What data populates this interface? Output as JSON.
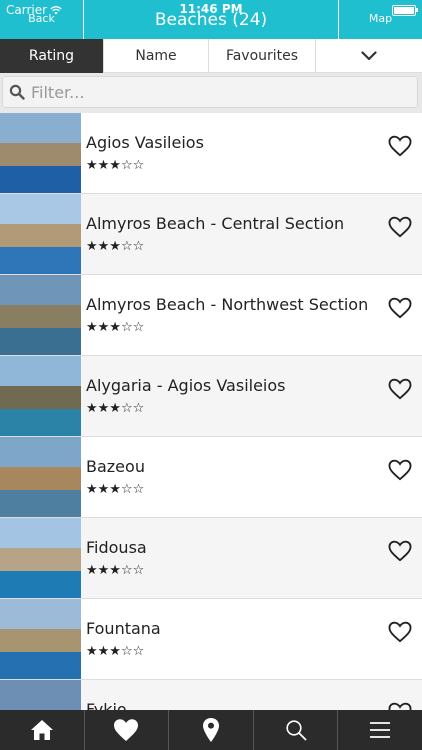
{
  "status": {
    "carrier": "Carrier",
    "time": "11:46 PM"
  },
  "header": {
    "back_label": "Back",
    "title": "Beaches (24)",
    "map_label": "Map"
  },
  "tabs": {
    "rating": "Rating",
    "name": "Name",
    "favourites": "Favourites"
  },
  "search": {
    "placeholder": "Filter..."
  },
  "beaches": [
    {
      "name": "Agios Vasileios",
      "stars": "★★★☆☆",
      "colors": {
        "sky": "#8aaed0",
        "land": "#9e8b6e",
        "sea": "#1f5fa5"
      }
    },
    {
      "name": "Almyros Beach - Central Section",
      "stars": "★★★☆☆",
      "colors": {
        "sky": "#a9c8e6",
        "land": "#b29a78",
        "sea": "#2f76b8"
      }
    },
    {
      "name": "Almyros Beach - Northwest Section",
      "stars": "★★★☆☆",
      "colors": {
        "sky": "#6f95b9",
        "land": "#8a7e62",
        "sea": "#3a6f92"
      }
    },
    {
      "name": "Alygaria - Agios Vasileios",
      "stars": "★★★☆☆",
      "colors": {
        "sky": "#90b7d8",
        "land": "#6f6a50",
        "sea": "#2b83a8"
      }
    },
    {
      "name": "Bazeou",
      "stars": "★★★☆☆",
      "colors": {
        "sky": "#7ea6c9",
        "land": "#a8865e",
        "sea": "#4e7fa0"
      }
    },
    {
      "name": "Fidousa",
      "stars": "★★★☆☆",
      "colors": {
        "sky": "#a3c5e3",
        "land": "#b7a488",
        "sea": "#1f7bb3"
      }
    },
    {
      "name": "Fountana",
      "stars": "★★★☆☆",
      "colors": {
        "sky": "#9bbbd9",
        "land": "#a79471",
        "sea": "#2470b0"
      }
    },
    {
      "name": "Fykio",
      "stars": "★★★☆☆",
      "colors": {
        "sky": "#6d8fb4",
        "land": "#8d8d8d",
        "sea": "#3d6a9a"
      }
    }
  ],
  "tabbar": [
    "home-icon",
    "heart-icon",
    "map-pin-icon",
    "search-icon",
    "menu-icon"
  ]
}
